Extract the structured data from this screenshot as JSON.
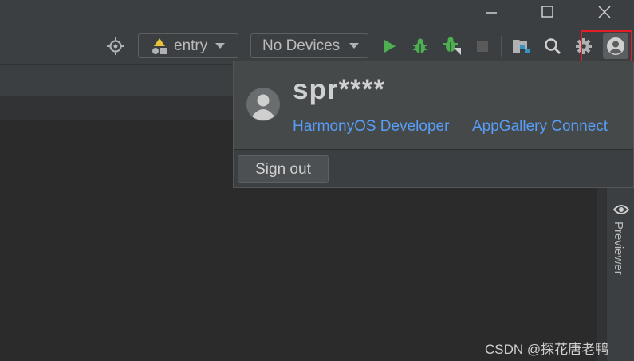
{
  "window_controls": {
    "minimize_icon": "minimize-icon",
    "maximize_icon": "maximize-icon",
    "close_icon": "close-icon"
  },
  "toolbar": {
    "module_dropdown": {
      "value": "entry"
    },
    "device_dropdown": {
      "value": "No Devices"
    },
    "colors": {
      "run": "#4caf50",
      "debug": "#4caf50",
      "stop": "#5a5a5a"
    }
  },
  "account_popup": {
    "username": "spr****",
    "links": [
      {
        "label": "HarmonyOS Developer"
      },
      {
        "label": "AppGallery Connect"
      }
    ],
    "sign_out_label": "Sign out"
  },
  "right_panel": {
    "previewer_label": "Previewer"
  },
  "watermark": "CSDN @探花唐老鸭"
}
